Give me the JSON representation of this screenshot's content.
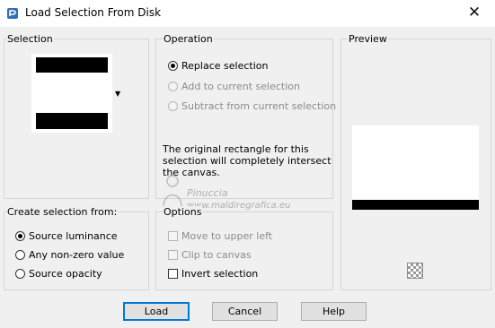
{
  "window": {
    "title": "Load Selection From Disk",
    "close_glyph": "✕"
  },
  "selection": {
    "label": "Selection",
    "dropdown_icon": "caret-down-icon"
  },
  "operation": {
    "label": "Operation",
    "options": [
      {
        "label": "Replace selection",
        "checked": true,
        "enabled": true
      },
      {
        "label": "Add to current selection",
        "checked": false,
        "enabled": false
      },
      {
        "label": "Subtract from current selection",
        "checked": false,
        "enabled": false
      }
    ],
    "info": "The original rectangle for this\nselection will completely intersect\nthe canvas."
  },
  "preview": {
    "label": "Preview",
    "icon": "transparency-checker-icon"
  },
  "create_from": {
    "label": "Create selection from:",
    "options": [
      {
        "label": "Source luminance",
        "checked": true
      },
      {
        "label": "Any non-zero value",
        "checked": false
      },
      {
        "label": "Source opacity",
        "checked": false
      }
    ]
  },
  "options": {
    "label": "Options",
    "items": [
      {
        "label": "Move to upper left",
        "checked": false,
        "enabled": false
      },
      {
        "label": "Clip to canvas",
        "checked": false,
        "enabled": false
      },
      {
        "label": "Invert selection",
        "checked": false,
        "enabled": true
      }
    ]
  },
  "watermark": {
    "line1": "Pinuccia",
    "line2": "www.maldiregrafica.eu"
  },
  "buttons": {
    "load": "Load",
    "cancel": "Cancel",
    "help": "Help"
  }
}
